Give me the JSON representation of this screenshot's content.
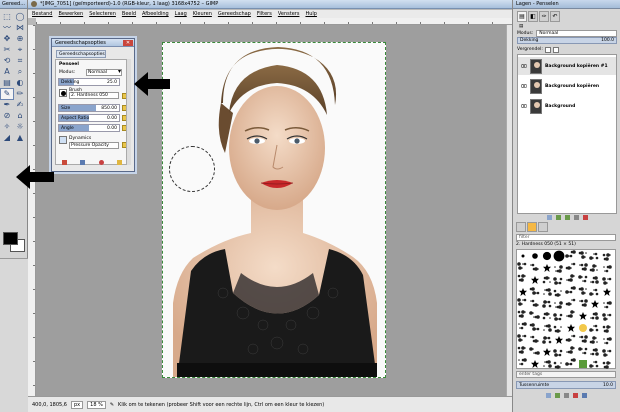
{
  "toolbox": {
    "title": "Gereed...",
    "tools": [
      "⬚",
      "◯",
      "〰",
      "⋈",
      "✥",
      "⊕",
      "✂",
      "⌖",
      "⟲",
      "⌗",
      "A",
      "⌕",
      "▤",
      "◐",
      "✎",
      "✏",
      "✒",
      "✍",
      "⊘",
      "⌂",
      "✧",
      "☼",
      "◢",
      "▲"
    ]
  },
  "window": {
    "title": "*[IMG_7051] (geïmporteerd)-1.0 (RGB-kleur, 1 laag) 3168x4752 – GIMP"
  },
  "menu": [
    "Bestand",
    "Bewerken",
    "Selecteren",
    "Beeld",
    "Afbeelding",
    "Laag",
    "Kleuren",
    "Gereedschap",
    "Filters",
    "Vensters",
    "Hulp"
  ],
  "status": {
    "coords": "400,0, 1805,6",
    "unit": "px",
    "zoom": "18 %",
    "message": "Klik om te tekenen (probeer Shift voor een rechte lijn, Ctrl om een kleur te kiezen)"
  },
  "tool_options": {
    "title": "Gereedschapsopties",
    "tab": "Gereedschapsopties",
    "section": "Penseel",
    "mode_label": "Modus:",
    "mode_value": "Normaal",
    "opacity": {
      "label": "Dekking",
      "value": "25.0",
      "fraction": 0.25
    },
    "brush_label": "Brush",
    "brush_name": "2. Hardness 050",
    "size": {
      "label": "Size",
      "value": "850.00",
      "fraction": 0.62
    },
    "aspect": {
      "label": "Aspect Ratio",
      "value": "0.00",
      "fraction": 0.5
    },
    "angle": {
      "label": "Angle",
      "value": "0.00",
      "fraction": 0.5
    },
    "dynamics_label": "Dynamics",
    "dynamics_value": "Pressure Opacity"
  },
  "layers": {
    "title": "Lagen - Penselen",
    "mode_label": "Modus:",
    "mode_value": "Normaal",
    "opacity_label": "Dekking",
    "opacity_value": "100.0",
    "lock_label": "Vergrendel:",
    "items": [
      {
        "name": "Background kopiëren #1",
        "selected": true
      },
      {
        "name": "Background kopiëren",
        "selected": false
      },
      {
        "name": "Background",
        "selected": false
      }
    ]
  },
  "brushes": {
    "filter_placeholder": "filter",
    "selected_name": "2. Hardness 050 (51 × 51)",
    "tag_placeholder": "enter tags",
    "spacing_label": "Tussenruimte",
    "spacing_value": "10.0"
  },
  "colors": {
    "foreground": "#000000",
    "background": "#ffffff",
    "accent": "#8aa4cc",
    "canvas_bg": "#9e9e9e"
  }
}
